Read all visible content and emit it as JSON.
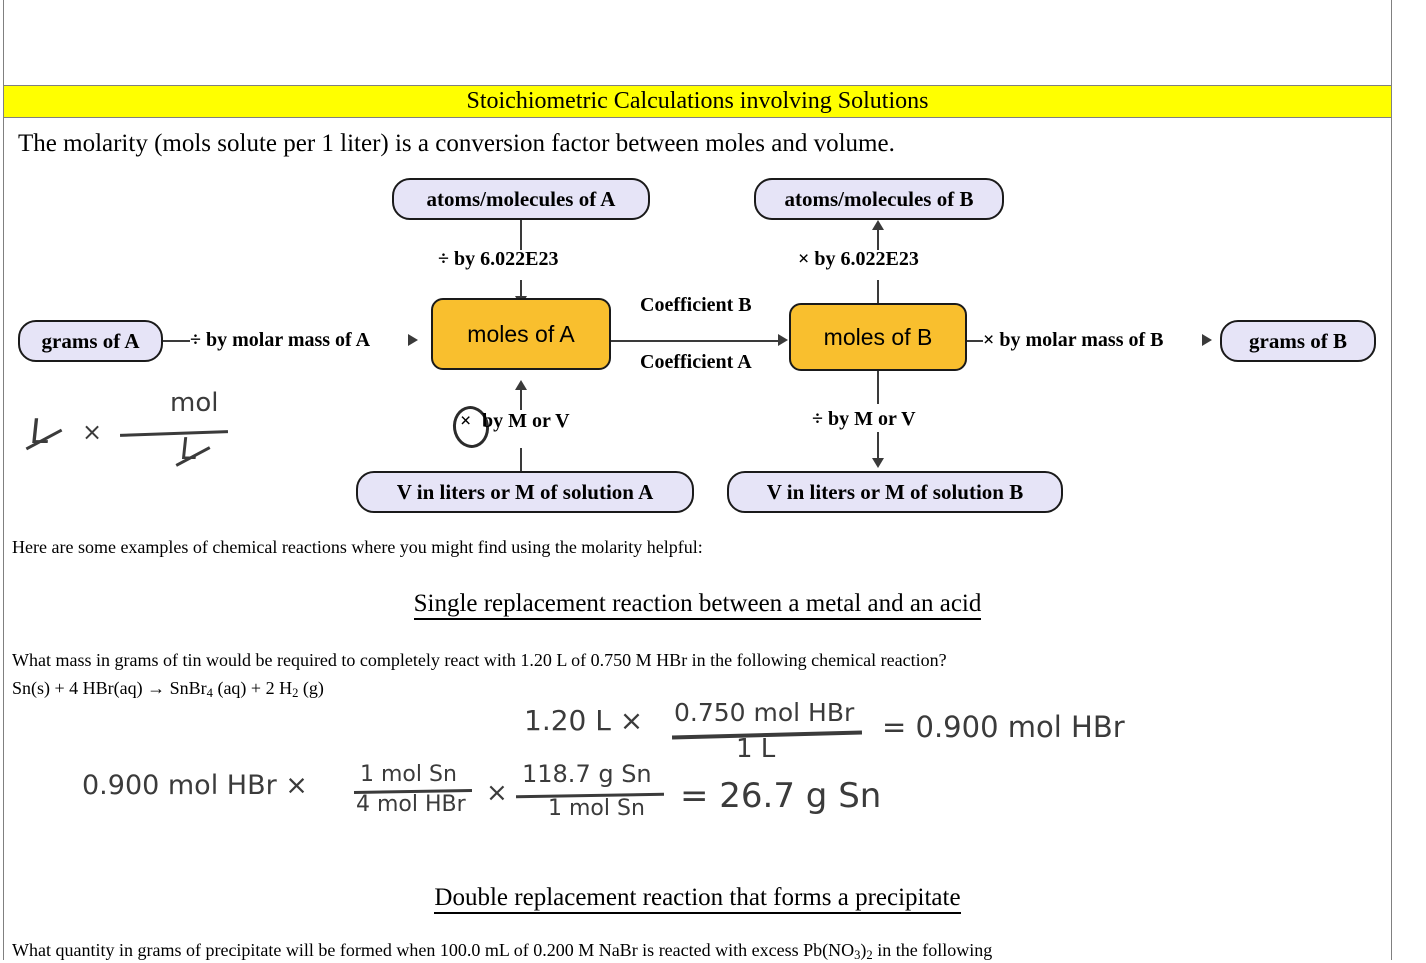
{
  "title": "Stoichiometric Calculations involving Solutions",
  "intro": "The molarity (mols solute per 1 liter) is a conversion factor between moles and volume.",
  "diagram": {
    "nodes": {
      "atoms_a": "atoms/molecules of A",
      "atoms_b": "atoms/molecules of B",
      "grams_a": "grams of A",
      "grams_b": "grams of B",
      "moles_a": "moles of A",
      "moles_b": "moles of B",
      "solution_a": "V in liters or M of solution A",
      "solution_b": "V in liters or M of solution B"
    },
    "edges": {
      "divide_avogadro": "÷ by  6.022E23",
      "multiply_avogadro": "× by  6.022E23",
      "divide_molar_mass_a": "÷ by molar mass of A",
      "multiply_molar_mass_b": "× by molar mass of B",
      "coefficient_b": "Coefficient B",
      "coefficient_a": "Coefficient A",
      "multiply_m_or_v_symbol": "×",
      "multiply_m_or_v": "by M or V",
      "divide_m_or_v": "÷ by M or V"
    },
    "colors": {
      "pill_fill": "#e6e4f7",
      "mole_fill": "#f9bf2e",
      "node_border": "#1a1a1a"
    }
  },
  "handwriting": {
    "cancel_note": {
      "l_left": "L",
      "times": "×",
      "numerator": "mol",
      "denominator": "L"
    },
    "calc_line1": {
      "lead": "1.20 L ×",
      "numerator": "0.750 mol HBr",
      "denominator": "1 L",
      "result": "= 0.900 mol HBr"
    },
    "calc_line2": {
      "lead": "0.900 mol HBr ×",
      "frac1_num": "1 mol Sn",
      "frac1_den": "4 mol HBr",
      "times": "×",
      "frac2_num": "118.7 g Sn",
      "frac2_den": "1 mol Sn",
      "result": "= 26.7 g Sn"
    }
  },
  "body": {
    "examples_intro": "Here are some examples of chemical reactions where you might find using the molarity helpful:",
    "section1_heading": "Single replacement reaction between a metal and an acid",
    "question1": "What mass in grams of tin would be required to completely react with 1.20 L of 0.750 M HBr in the following chemical reaction?",
    "equation1_parts": {
      "p1": "Sn(s) + 4 HBr(aq) → SnBr",
      "sub1": "4",
      "p2": " (aq) + 2 H",
      "sub2": "2",
      "p3": " (g)"
    },
    "section2_heading": "Double replacement reaction that forms a precipitate",
    "question2_parts": {
      "p1": "What quantity in grams of precipitate will be formed when 100.0 mL of 0.200 M NaBr is reacted with excess Pb(NO",
      "sub1": "3",
      "p2": ")",
      "sub2": "2",
      "p3": " in the following"
    }
  },
  "colors": {
    "banner": "#ffff00",
    "border": "#808080",
    "text": "#000000",
    "ink": "#3b3b3b"
  }
}
